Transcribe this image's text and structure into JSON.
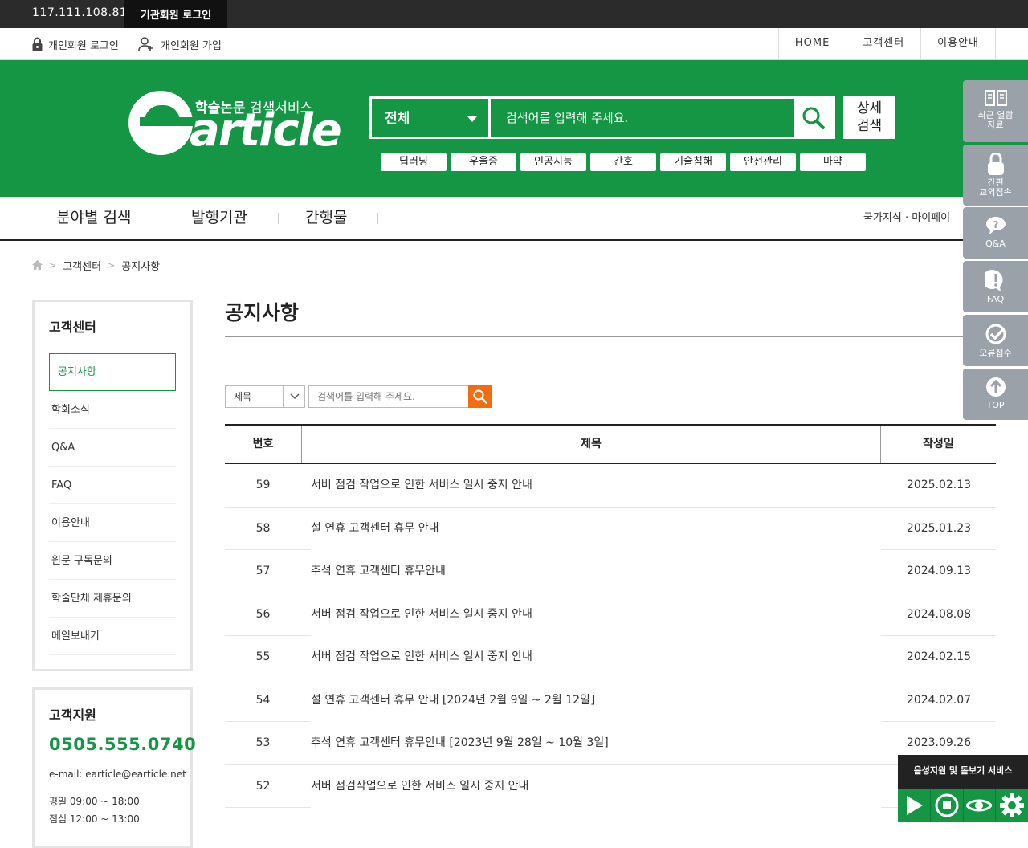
{
  "topbar": {
    "ip": "117.111.108.81",
    "institution_login": "기관회원 로그인"
  },
  "utilbar": {
    "login": "개인회원 로그인",
    "join": "개인회원 가입",
    "right": [
      "HOME",
      "고객센터",
      "이용안내"
    ]
  },
  "header": {
    "logo_sub_bold": "학술논문",
    "logo_sub_thin": " 검색서비스",
    "logo_word": "article",
    "scope": "전체",
    "search_placeholder": "검색어를 입력해 주세요.",
    "detail_search": "상세\n검색",
    "keywords": [
      "딥러닝",
      "우울증",
      "인공지능",
      "간호",
      "기술침해",
      "안전관리",
      "마약"
    ]
  },
  "gnb": {
    "items": [
      "분야별 검색",
      "발행기관",
      "간행물"
    ],
    "right": "국가지식 · 마이페이"
  },
  "breadcrumb": [
    "고객센터",
    "공지사항"
  ],
  "lnb": {
    "title": "고객센터",
    "items": [
      "공지사항",
      "학회소식",
      "Q&A",
      "FAQ",
      "이용안내",
      "원문 구독문의",
      "학술단체 제휴문의",
      "메일보내기"
    ]
  },
  "support": {
    "title": "고객지원",
    "phone": "0505.555.0740",
    "email": "e-mail: earticle@earticle.net",
    "hours_weekday": "평일 09:00 ~ 18:00",
    "hours_lunch": "점심 12:00 ~ 13:00"
  },
  "main": {
    "title": "공지사항",
    "filter_field": "제목",
    "filter_placeholder": "검색어를 입력해 주세요.",
    "columns": [
      "번호",
      "제목",
      "작성일"
    ],
    "rows": [
      {
        "no": "59",
        "title": "서버 점검 작업으로 인한 서비스 일시 중지 안내",
        "date": "2025.02.13"
      },
      {
        "no": "58",
        "title": "설 연휴 고객센터 휴무 안내",
        "date": "2025.01.23"
      },
      {
        "no": "57",
        "title": "추석 연휴 고객센터 휴무안내",
        "date": "2024.09.13"
      },
      {
        "no": "56",
        "title": "서버 점검 작업으로 인한 서비스 일시 중지 안내",
        "date": "2024.08.08"
      },
      {
        "no": "55",
        "title": "서버 점검 작업으로 인한 서비스 일시 중지 안내",
        "date": "2024.02.15"
      },
      {
        "no": "54",
        "title": "설 연휴 고객센터 휴무 안내 [2024년 2월 9일 ~ 2월 12일]",
        "date": "2024.02.07"
      },
      {
        "no": "53",
        "title": "추석 연휴 고객센터 휴무안내 [2023년 9월 28일 ~ 10월 3일]",
        "date": "2023.09.26"
      },
      {
        "no": "52",
        "title": "서버 점검작업으로 인한 서비스 일시 중지 안내",
        "date": ""
      }
    ]
  },
  "quickmenu": [
    {
      "label": "최근 열람\n자료",
      "icon": "book-icon"
    },
    {
      "label": "간편\n교외접속",
      "icon": "lock-icon"
    },
    {
      "label": "Q&A",
      "icon": "question-icon"
    },
    {
      "label": "FAQ",
      "icon": "exclamation-icon"
    },
    {
      "label": "오류접수",
      "icon": "check-icon"
    },
    {
      "label": "TOP",
      "icon": "arrow-up-icon"
    }
  ],
  "voice": {
    "title": "음성지원 및 돋보기 서비스"
  },
  "colors": {
    "brand_green": "#149644",
    "accent_orange": "#f26d12",
    "quick_gray": "#9aa1a9"
  }
}
